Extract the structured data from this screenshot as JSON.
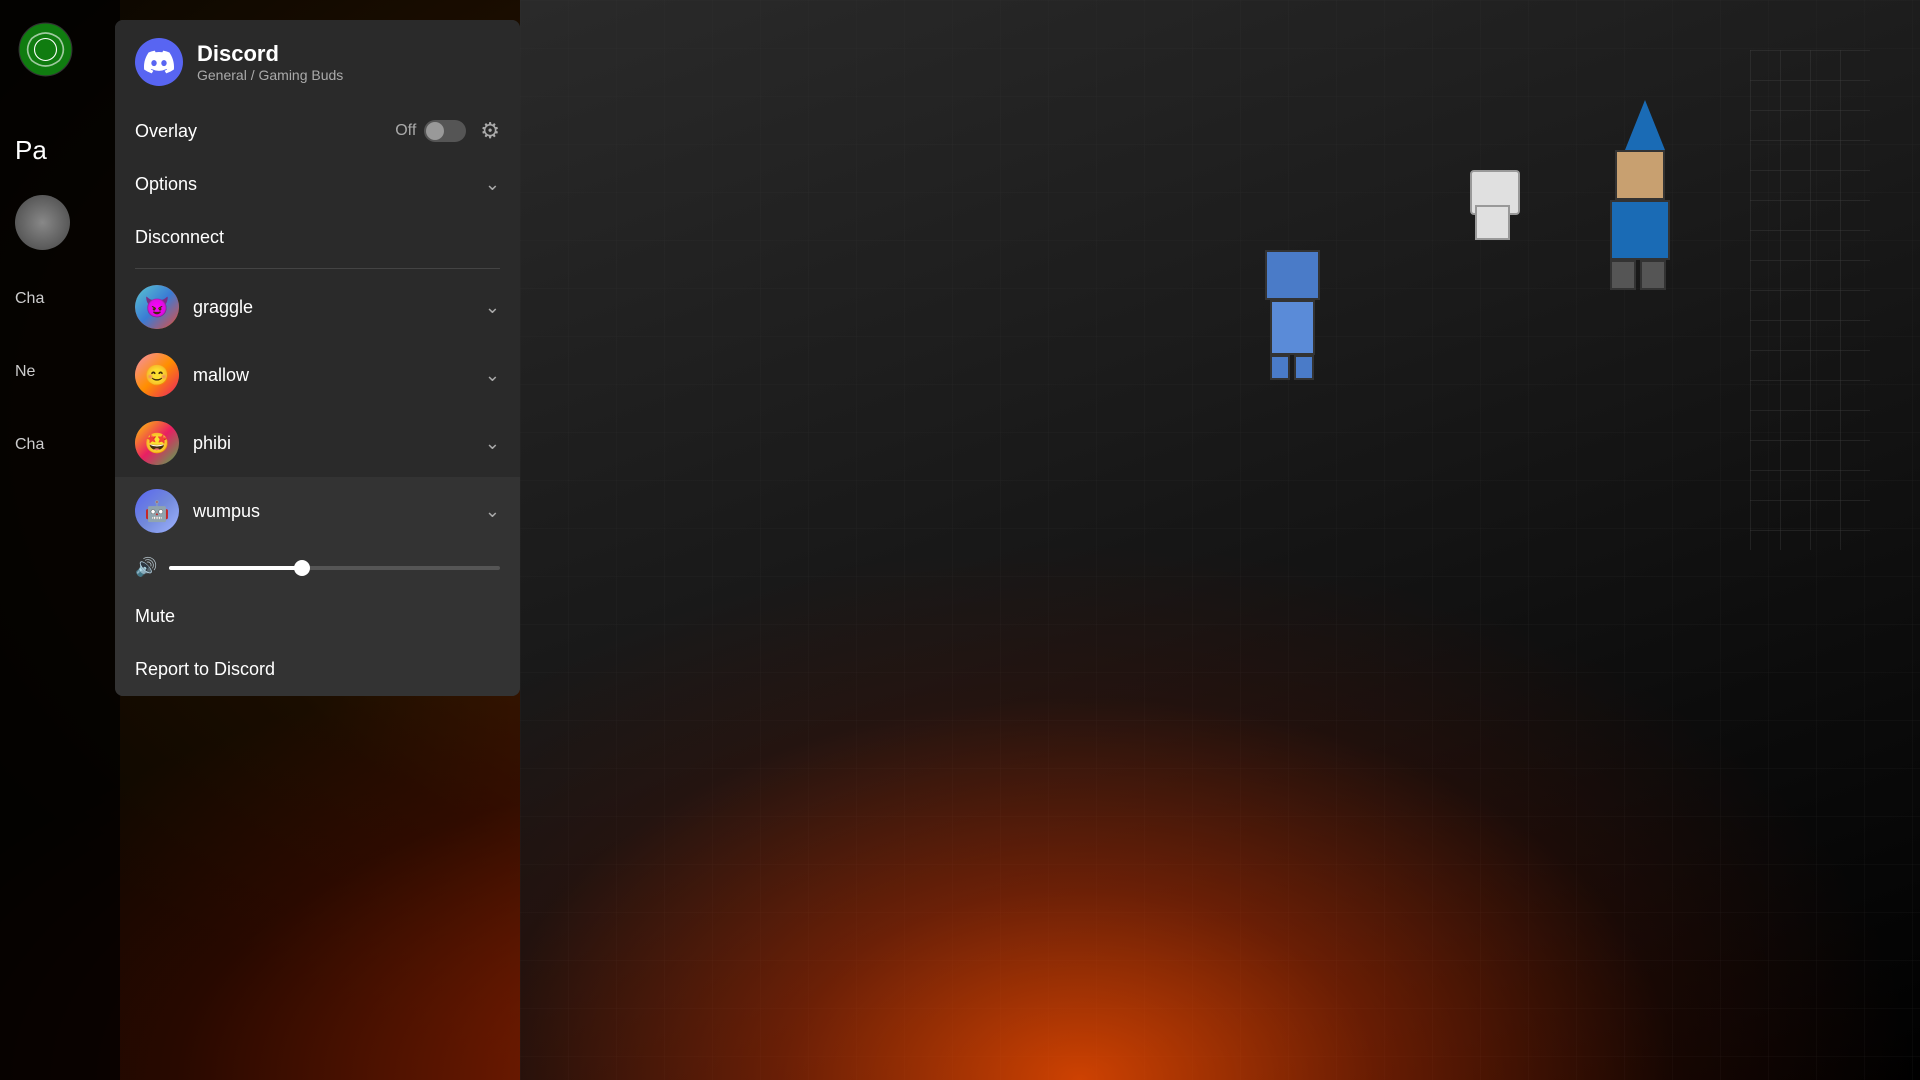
{
  "panel": {
    "app_name": "Discord",
    "app_subtitle": "General / Gaming Buds",
    "overlay_label": "Overlay",
    "overlay_state": "Off",
    "options_label": "Options",
    "disconnect_label": "Disconnect"
  },
  "users": [
    {
      "id": "graggle",
      "name": "graggle",
      "avatar_class": "avatar-graggle",
      "expanded": false
    },
    {
      "id": "mallow",
      "name": "mallow",
      "avatar_class": "avatar-mallow",
      "expanded": false
    },
    {
      "id": "phibi",
      "name": "phibi",
      "avatar_class": "avatar-phibi",
      "expanded": false
    },
    {
      "id": "wumpus",
      "name": "wumpus",
      "avatar_class": "avatar-wumpus",
      "expanded": true
    }
  ],
  "wumpus_controls": {
    "mute_label": "Mute",
    "report_label": "Report to Discord"
  },
  "left_sidebar": {
    "page_label": "Pa",
    "nav_items": [
      "Cha",
      "Ne",
      "Cha"
    ]
  },
  "icons": {
    "chevron_down": "⌄",
    "gear": "⚙",
    "volume": "🔊"
  },
  "colors": {
    "discord_blue": "#5865F2",
    "panel_bg": "#2a2a2a",
    "expanded_bg": "#333333",
    "text_primary": "#ffffff",
    "text_secondary": "#aaaaaa",
    "divider": "#444444"
  }
}
